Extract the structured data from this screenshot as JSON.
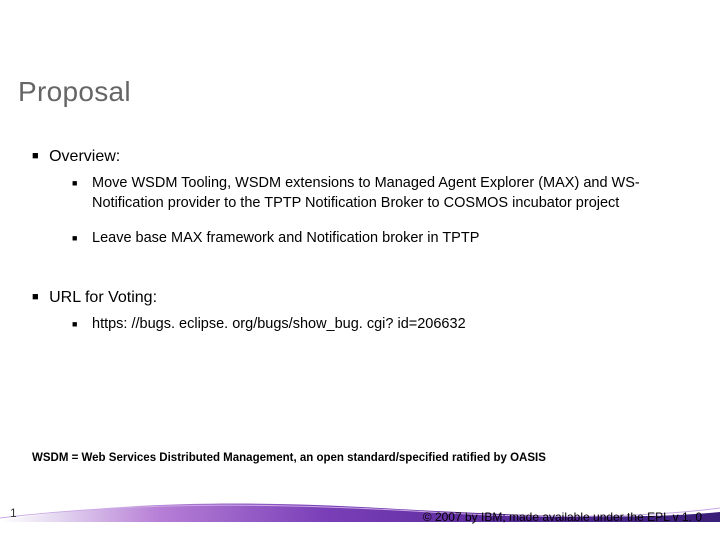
{
  "title": "Proposal",
  "overview": {
    "heading": "Overview:",
    "items": [
      " Move WSDM Tooling, WSDM extensions to Managed Agent Explorer (MAX) and WS-Notification provider to the TPTP Notification Broker to COSMOS incubator project",
      "Leave base MAX framework and Notification broker in TPTP"
    ]
  },
  "url_section": {
    "heading": "URL for Voting:",
    "items": [
      "https: //bugs. eclipse. org/bugs/show_bug. cgi? id=206632"
    ]
  },
  "footnote": "WSDM = Web Services Distributed Management, an open standard/specified ratified by OASIS",
  "footer": {
    "page_number": "1",
    "copyright": "© 2007 by IBM; made available under the EPL v 1. 0"
  }
}
